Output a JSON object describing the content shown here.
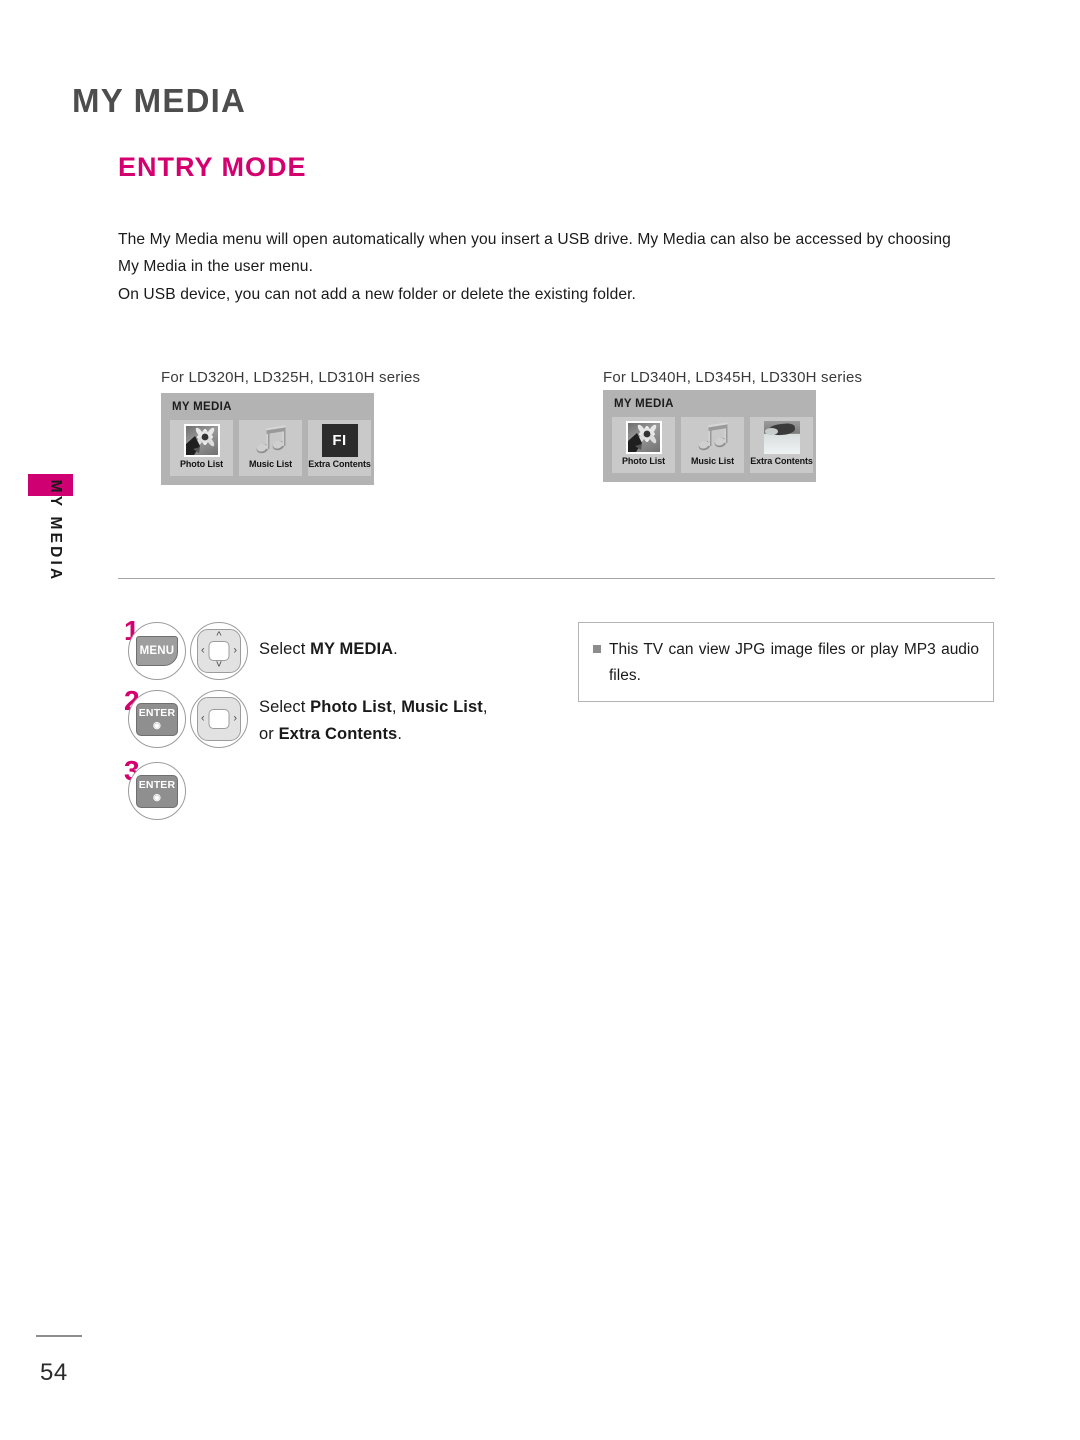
{
  "document": {
    "chapter_title": "MY MEDIA",
    "section_title": "ENTRY MODE",
    "side_tab_label": "MY MEDIA",
    "page_number": "54"
  },
  "intro": {
    "paragraph1": "The My Media menu will open automatically when you insert a USB drive. My Media can also be accessed by choosing My Media in the user menu.",
    "paragraph2": "On USB device, you can not add a new folder or delete the existing folder."
  },
  "mockups": [
    {
      "caption": "For LD320H, LD325H, LD310H series",
      "screen_title": "MY MEDIA",
      "tiles": [
        {
          "label": "Photo List",
          "icon": "photo-thumbnail-icon"
        },
        {
          "label": "Music List",
          "icon": "music-note-icon"
        },
        {
          "label": "Extra Contents",
          "icon": "fi-logo-icon",
          "icon_text": "FI"
        }
      ]
    },
    {
      "caption": "For LD340H, LD345H, LD330H series",
      "screen_title": "MY MEDIA",
      "tiles": [
        {
          "label": "Photo List",
          "icon": "photo-thumbnail-icon"
        },
        {
          "label": "Music List",
          "icon": "music-note-icon"
        },
        {
          "label": "Extra Contents",
          "icon": "image-thumbnail-icon"
        }
      ]
    }
  ],
  "steps": [
    {
      "number": "1",
      "keys": [
        {
          "type": "button",
          "label": "MENU",
          "name": "menu-key"
        },
        {
          "type": "nav",
          "arrows": "updownleftright",
          "name": "nav-wheel-4way"
        }
      ],
      "text_plain": "Select MY MEDIA.",
      "text_prefix": "Select ",
      "text_bold": "MY MEDIA",
      "text_suffix": "."
    },
    {
      "number": "2",
      "keys": [
        {
          "type": "button",
          "label": "ENTER",
          "name": "enter-key"
        },
        {
          "type": "nav",
          "arrows": "leftright",
          "name": "nav-wheel-lr"
        }
      ],
      "line1_prefix": "Select ",
      "line1_bold1": "Photo List",
      "line1_mid": ", ",
      "line1_bold2": "Music List",
      "line1_suffix": ",",
      "line2_prefix": "or ",
      "line2_bold": "Extra Contents",
      "line2_suffix": "."
    },
    {
      "number": "3",
      "keys": [
        {
          "type": "button",
          "label": "ENTER",
          "name": "enter-key"
        }
      ]
    }
  ],
  "note": {
    "bullet": "square-bullet-icon",
    "text": "This TV can view JPG image files or play MP3 audio files."
  },
  "colors": {
    "accent_magenta": "#d4006f",
    "tab_magenta": "#cf0072",
    "chapter_gray": "#4d4d4d",
    "panel_gray": "#b3b3b3",
    "tile_gray": "#c9c9c9"
  }
}
